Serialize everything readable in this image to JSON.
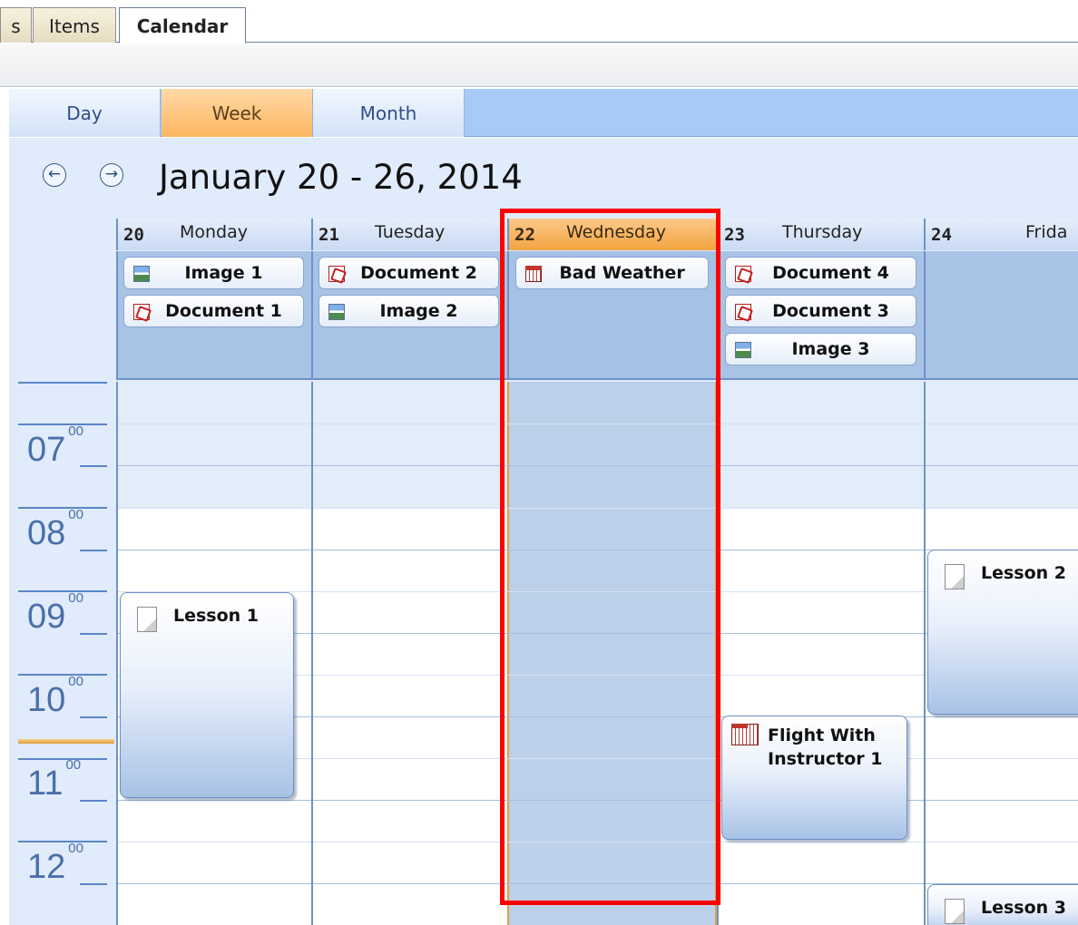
{
  "tabs": [
    {
      "label": "s"
    },
    {
      "label": "Items"
    },
    {
      "label": "Calendar",
      "active": true
    }
  ],
  "views": [
    {
      "label": "Day"
    },
    {
      "label": "Week",
      "active": true
    },
    {
      "label": "Month"
    }
  ],
  "nav": {
    "prev_icon": "arrow-left-circle-icon",
    "next_icon": "arrow-right-circle-icon",
    "prev": "←",
    "next": "→"
  },
  "range_title": "January 20 - 26, 2014",
  "days": [
    {
      "num": "20",
      "name": "Monday"
    },
    {
      "num": "21",
      "name": "Tuesday"
    },
    {
      "num": "22",
      "name": "Wednesday",
      "today": true
    },
    {
      "num": "23",
      "name": "Thursday"
    },
    {
      "num": "24",
      "name": "Frida"
    }
  ],
  "allday_events": {
    "monday": [
      "Image 1",
      "Document 1"
    ],
    "tuesday": [
      "Document 2",
      "Image 2"
    ],
    "wednesday": [
      "Bad Weather"
    ],
    "thursday": [
      "Document 4",
      "Document 3",
      "Image 3"
    ]
  },
  "hours": [
    {
      "hour": "07",
      "minutes": "00"
    },
    {
      "hour": "08",
      "minutes": "00"
    },
    {
      "hour": "09",
      "minutes": "00"
    },
    {
      "hour": "10",
      "minutes": "00"
    },
    {
      "hour": "11",
      "minutes": "00"
    },
    {
      "hour": "12",
      "minutes": "00"
    }
  ],
  "appointments": {
    "lesson1": "Lesson 1",
    "lesson2": "Lesson 2",
    "lesson3": "Lesson 3",
    "flight_line1": "Flight With",
    "flight_line2": "Instructor 1"
  },
  "colors": {
    "accent_today": "#f3a440",
    "highlight_border": "#ff0000",
    "view_active": "#fdb660",
    "allday_bg": "#a9c3e6",
    "time_label": "#4a6fa8"
  }
}
